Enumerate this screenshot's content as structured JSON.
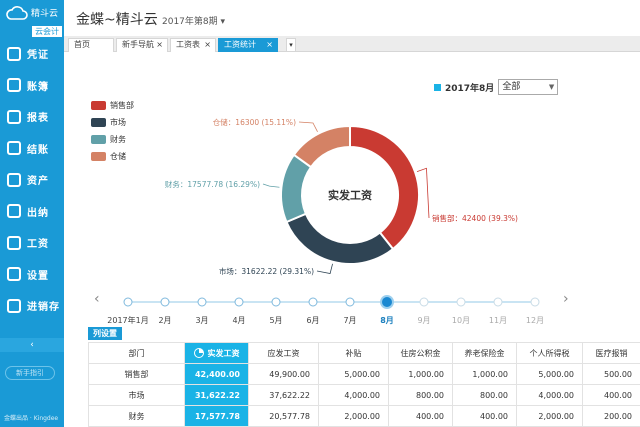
{
  "brand": {
    "name": "精斗云",
    "sub": "云会计",
    "footer": "金蝶出品 · Kingdee"
  },
  "sidebar": {
    "items": [
      {
        "label": "凭证",
        "icon": "voucher-icon"
      },
      {
        "label": "账簿",
        "icon": "ledger-icon"
      },
      {
        "label": "报表",
        "icon": "report-icon"
      },
      {
        "label": "结账",
        "icon": "checkout-icon"
      },
      {
        "label": "资产",
        "icon": "asset-icon"
      },
      {
        "label": "出纳",
        "icon": "cashier-icon"
      },
      {
        "label": "工资",
        "icon": "salary-icon"
      },
      {
        "label": "设置",
        "icon": "settings-icon"
      },
      {
        "label": "进销存",
        "icon": "inventory-icon"
      }
    ],
    "collapse_label": "‹",
    "user_pill": "新手指引"
  },
  "header": {
    "title": "金蝶~精斗云",
    "period": "2017年第8期"
  },
  "tabs": [
    {
      "label": "首页",
      "closable": false
    },
    {
      "label": "新手导航",
      "closable": true
    },
    {
      "label": "工资表",
      "closable": true
    },
    {
      "label": "工资统计",
      "closable": true,
      "active": true
    }
  ],
  "filter": {
    "period": "2017年8月",
    "select_value": "全部"
  },
  "chart_data": {
    "type": "pie",
    "center_label": "实发工资",
    "slices": [
      {
        "name": "销售部",
        "value": 42400,
        "percent": "39.3%",
        "label": "销售部：42400 (39.3%)",
        "color": "#c93a32"
      },
      {
        "name": "市场",
        "value": 31622.22,
        "percent": "29.31%",
        "label": "市场：31622.22 (29.31%)",
        "color": "#2f4454"
      },
      {
        "name": "财务",
        "value": 17577.78,
        "percent": "16.29%",
        "label": "财务：17577.78 (16.29%)",
        "color": "#61a0a8"
      },
      {
        "name": "仓储",
        "value": 16300,
        "percent": "15.11%",
        "label": "仓储：16300 (15.11%)",
        "color": "#d48265"
      }
    ]
  },
  "timeline": {
    "months": [
      "2017年1月",
      "2月",
      "3月",
      "4月",
      "5月",
      "6月",
      "7月",
      "8月",
      "9月",
      "10月",
      "11月",
      "12月"
    ],
    "active_index": 7
  },
  "table": {
    "settings_label": "列设置",
    "headers": [
      "部门",
      "实发工资",
      "应发工资",
      "补贴",
      "住房公积金",
      "养老保险金",
      "个人所得税",
      "医疗报销"
    ],
    "rows": [
      [
        "销售部",
        "42,400.00",
        "49,900.00",
        "5,000.00",
        "1,000.00",
        "1,000.00",
        "5,000.00",
        "500.00"
      ],
      [
        "市场",
        "31,622.22",
        "37,622.22",
        "4,000.00",
        "800.00",
        "800.00",
        "4,000.00",
        "400.00"
      ],
      [
        "财务",
        "17,577.78",
        "20,577.78",
        "2,000.00",
        "400.00",
        "400.00",
        "2,000.00",
        "200.00"
      ]
    ]
  },
  "colors": {
    "primary": "#1a9ad6",
    "highlight": "#1ab3e6"
  }
}
